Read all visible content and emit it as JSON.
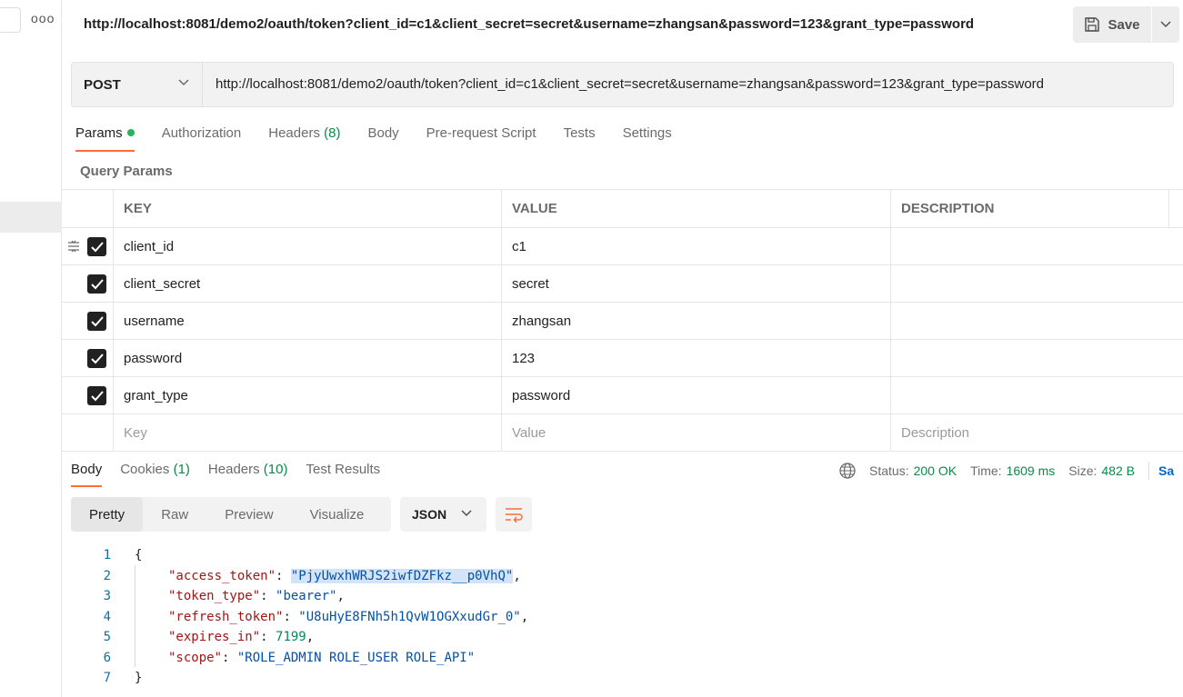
{
  "header": {
    "title": "http://localhost:8081/demo2/oauth/token?client_id=c1&client_secret=secret&username=zhangsan&password=123&grant_type=password",
    "save_label": "Save"
  },
  "sidebar": {
    "more_label": "ooo"
  },
  "request": {
    "method": "POST",
    "url": "http://localhost:8081/demo2/oauth/token?client_id=c1&client_secret=secret&username=zhangsan&password=123&grant_type=password"
  },
  "tabs": [
    {
      "label": "Params",
      "active": true
    },
    {
      "label": "Authorization"
    },
    {
      "label": "Headers",
      "count": "(8)"
    },
    {
      "label": "Body"
    },
    {
      "label": "Pre-request Script"
    },
    {
      "label": "Tests"
    },
    {
      "label": "Settings"
    }
  ],
  "query_params": {
    "label": "Query Params",
    "columns": [
      "KEY",
      "VALUE",
      "DESCRIPTION"
    ],
    "rows": [
      {
        "key": "client_id",
        "value": "c1",
        "checked": true
      },
      {
        "key": "client_secret",
        "value": "secret",
        "checked": true
      },
      {
        "key": "username",
        "value": "zhangsan",
        "checked": true
      },
      {
        "key": "password",
        "value": "123",
        "checked": true
      },
      {
        "key": "grant_type",
        "value": "password",
        "checked": true
      }
    ],
    "placeholders": {
      "key": "Key",
      "value": "Value",
      "description": "Description"
    }
  },
  "response": {
    "tabs": [
      {
        "label": "Body",
        "active": true
      },
      {
        "label": "Cookies",
        "count": "(1)"
      },
      {
        "label": "Headers",
        "count": "(10)"
      },
      {
        "label": "Test Results"
      }
    ],
    "status_label": "Status:",
    "status_value": "200 OK",
    "time_label": "Time:",
    "time_value": "1609 ms",
    "size_label": "Size:",
    "size_value": "482 B",
    "save_label": "Sa",
    "views": [
      "Pretty",
      "Raw",
      "Preview",
      "Visualize"
    ],
    "active_view": "Pretty",
    "format": "JSON",
    "body": {
      "open": "{",
      "close": "}",
      "access_token_key": "\"access_token\"",
      "access_token_value": "\"PjyUwxhWRJS2iwfDZFkz__p0VhQ\"",
      "token_type_key": "\"token_type\"",
      "token_type_value": "\"bearer\"",
      "refresh_token_key": "\"refresh_token\"",
      "refresh_token_value": "\"U8uHyE8FNh5h1QvW1OGXxudGr_0\"",
      "expires_in_key": "\"expires_in\"",
      "expires_in_value": "7199",
      "scope_key": "\"scope\"",
      "scope_value": "\"ROLE_ADMIN ROLE_USER ROLE_API\""
    },
    "line_numbers": [
      "1",
      "2",
      "3",
      "4",
      "5",
      "6",
      "7"
    ]
  },
  "colors": {
    "accent": "#ff6c37",
    "success": "#0c8a4a",
    "link": "#0265d2"
  }
}
